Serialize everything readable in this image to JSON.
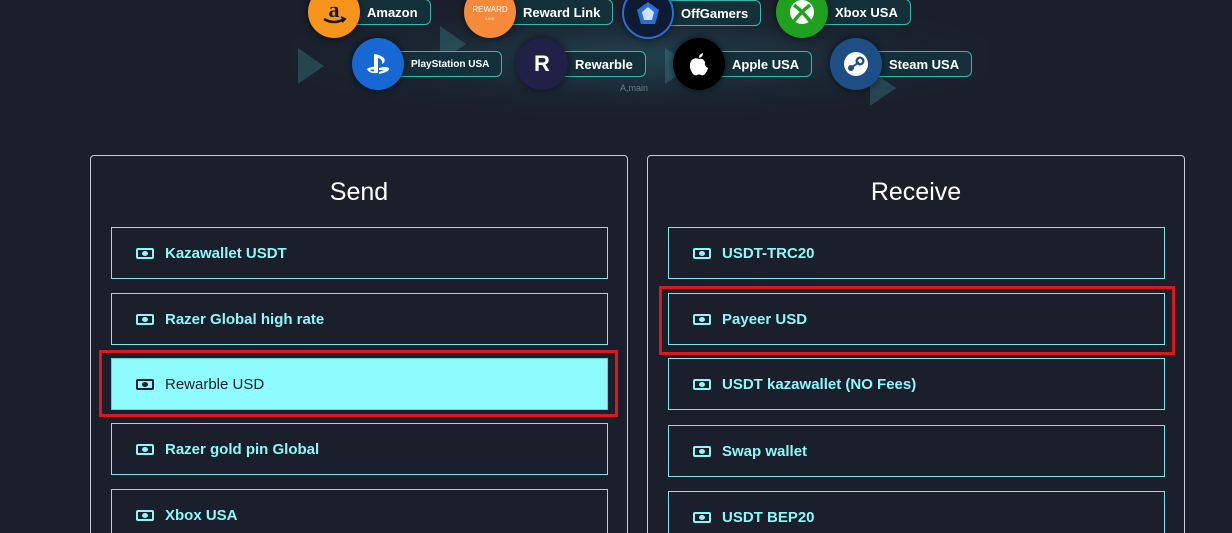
{
  "banner": {
    "brands_row1": [
      {
        "label": "Amazon",
        "icon": "amazon-icon",
        "color": "#f7941d"
      },
      {
        "label": "Reward Link",
        "icon": "reward-link-icon",
        "color": "#f48a3a",
        "logo_text": "REWARD",
        "logo_sub": "LINK"
      },
      {
        "label": "OffGamers",
        "icon": "offgamers-icon",
        "color": "#2a6fd6"
      },
      {
        "label": "Xbox USA",
        "icon": "xbox-icon",
        "color": "#1fa01f"
      }
    ],
    "brands_row2": [
      {
        "label": "PlayStation USA",
        "icon": "playstation-icon",
        "color": "#1868d4"
      },
      {
        "label": "Rewarble",
        "icon": "rewarble-icon",
        "color": "#202048",
        "logo_text": "R"
      },
      {
        "label": "Apple USA",
        "icon": "apple-icon",
        "color": "#000000"
      },
      {
        "label": "Steam USA",
        "icon": "steam-icon",
        "color": "#1d4f86"
      }
    ],
    "caption": "A,main"
  },
  "send": {
    "title": "Send",
    "options": [
      {
        "label": "Kazawallet USDT",
        "selected": false
      },
      {
        "label": "Razer Global high rate",
        "selected": false
      },
      {
        "label": "Rewarble USD",
        "selected": true
      },
      {
        "label": "Razer gold pin Global",
        "selected": false
      },
      {
        "label": "Xbox USA",
        "selected": false
      }
    ]
  },
  "receive": {
    "title": "Receive",
    "options": [
      {
        "label": "USDT-TRC20",
        "selected": false
      },
      {
        "label": "Payeer USD",
        "selected": false
      },
      {
        "label": "USDT kazawallet (NO Fees)",
        "selected": false
      },
      {
        "label": "Swap wallet",
        "selected": false
      },
      {
        "label": "USDT BEP20",
        "selected": false
      }
    ]
  },
  "colors": {
    "background": "#1a1f2b",
    "accent": "#8efcff",
    "highlight": "#d9181f"
  }
}
